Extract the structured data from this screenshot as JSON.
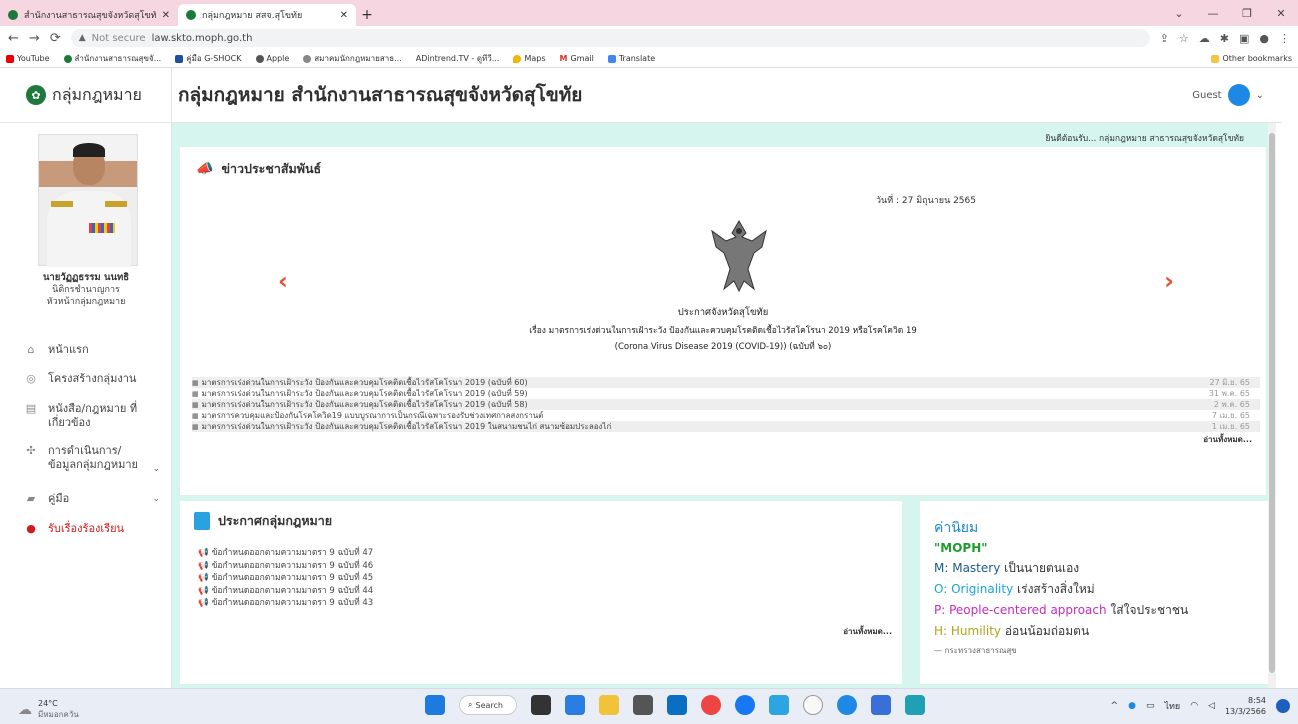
{
  "browser": {
    "tabs": [
      {
        "label": "สำนักงานสาธารณสุขจังหวัดสุโขทัย",
        "active": false
      },
      {
        "label": "กลุ่มกฎหมาย สสจ.สุโขทัย",
        "active": true
      }
    ],
    "address": {
      "warning": "Not secure",
      "url": "law.skto.moph.go.th"
    },
    "bookmarks": [
      "YouTube",
      "สำนักงานสาธารณสุขจั...",
      "คู่มือ G-SHOCK",
      "Apple",
      "สมาคมนักกฎหมายสาธ...",
      "ADintrend.TV - ดูทีวี...",
      "Maps",
      "Gmail",
      "Translate"
    ],
    "other_bookmarks": "Other bookmarks"
  },
  "sidebar": {
    "logo_text": "กลุ่มกฎหมาย",
    "person_name": "นายวัฏฏธรรม นนทธิ",
    "person_pos1": "นิติกรชำนาญการ",
    "person_pos2": "หัวหน้ากลุ่มกฎหมาย",
    "menu": [
      {
        "label": "หน้าแรก",
        "icon": "home-icon"
      },
      {
        "label": "โครงสร้างกลุ่มงาน",
        "icon": "user-circle-icon"
      },
      {
        "label": "หนังสือ/กฎหมาย ที่เกี่ยวข้อง",
        "icon": "book-icon"
      },
      {
        "label": "การดำเนินการ/ข้อมูลกลุ่มกฎหมาย",
        "icon": "group-icon"
      },
      {
        "label": "คู่มือ",
        "icon": "manual-icon"
      },
      {
        "label": "รับเรื่องร้องเรียน",
        "icon": "chat-icon"
      }
    ]
  },
  "header": {
    "title": "กลุ่มกฎหมาย สำนักงานสาธารณสุขจังหวัดสุโขทัย",
    "user": "Guest"
  },
  "welcome": "ยินดีต้อนรับ... กลุ่มกฎหมาย สาธารณสุขจังหวัดสุโขทัย",
  "news": {
    "title": "ข่าวประชาสัมพันธ์",
    "slide": {
      "date": "วันที่ : 27 มิถุนายน 2565",
      "heading": "ประกาศจังหวัดสุโขทัย",
      "line1": "เรื่อง มาตรการเร่งด่วนในการเฝ้าระวัง ป้องกันและควบคุมโรคติดเชื้อไวรัสโคโรนา 2019 หรือโรคโควิด 19",
      "line2": "(Corona Virus Disease 2019 (COVID-19)) (ฉบับที่ ๖๐)"
    },
    "items": [
      {
        "title": "มาตรการเร่งด่วนในการเฝ้าระวัง ป้องกันและควบคุมโรคติดเชื้อไวรัสโคโรนา 2019 (ฉบับที่ 60)",
        "date": "27 มิ.ย. 65"
      },
      {
        "title": "มาตรการเร่งด่วนในการเฝ้าระวัง ป้องกันและควบคุมโรคติดเชื้อไวรัสโคโรนา 2019 (ฉบับที่ 59)",
        "date": "31 พ.ค. 65"
      },
      {
        "title": "มาตรการเร่งด่วนในการเฝ้าระวัง ป้องกันและควบคุมโรคติดเชื้อไวรัสโคโรนา 2019 (ฉบับที่ 58)",
        "date": "2 พ.ค. 65"
      },
      {
        "title": "มาตรการควบคุมและป้องกันโรคโควิด19 แบบบูรณาการเป็นกรณีเฉพาะรองรับช่วงเทศกาลสงกรานต์",
        "date": "7 เม.ย. 65"
      },
      {
        "title": "มาตรการเร่งด่วนในการเฝ้าระวัง ป้องกันและควบคุมโรคติดเชื้อไวรัสโคโรนา 2019 ในสนามชนไก่ สนามซ้อมประลองไก่",
        "date": "1 เม.ย. 65"
      }
    ],
    "read_all": "อ่านทั้งหมด..."
  },
  "laws": {
    "title": "ประกาศกลุ่มกฎหมาย",
    "items": [
      "ข้อกำหนดออกตามความมาตรา 9 ฉบับที่ 47",
      "ข้อกำหนดออกตามความมาตรา 9 ฉบับที่ 46",
      "ข้อกำหนดออกตามความมาตรา 9 ฉบับที่ 45",
      "ข้อกำหนดออกตามความมาตรา 9 ฉบับที่ 44",
      "ข้อกำหนดออกตามความมาตรา 9 ฉบับที่ 43"
    ],
    "read_all": "อ่านทั้งหมด..."
  },
  "values": {
    "title": "ค่านิยม",
    "moph": "\"MOPH\"",
    "lines": [
      {
        "en": "M: Mastery",
        "th": " เป็นนายตนเอง",
        "color": "#1a5c8a"
      },
      {
        "en": "O: Originality",
        "th": " เร่งสร้างสิ่งใหม่",
        "color": "#19a7d8"
      },
      {
        "en": "P: People-centered approach",
        "th": " ใส่ใจประชาชน",
        "color": "#c42cbf"
      },
      {
        "en": "H: Humility",
        "th": " อ่อนน้อมถ่อมตน",
        "color": "#b5a216"
      }
    ],
    "cite": "— กระทรวงสาธารณสุข"
  },
  "taskbar": {
    "temp": "24°C",
    "weather": "มีหมอกควัน",
    "search": "Search",
    "lang": "ไทย",
    "time": "8:54",
    "date": "13/3/2566"
  }
}
